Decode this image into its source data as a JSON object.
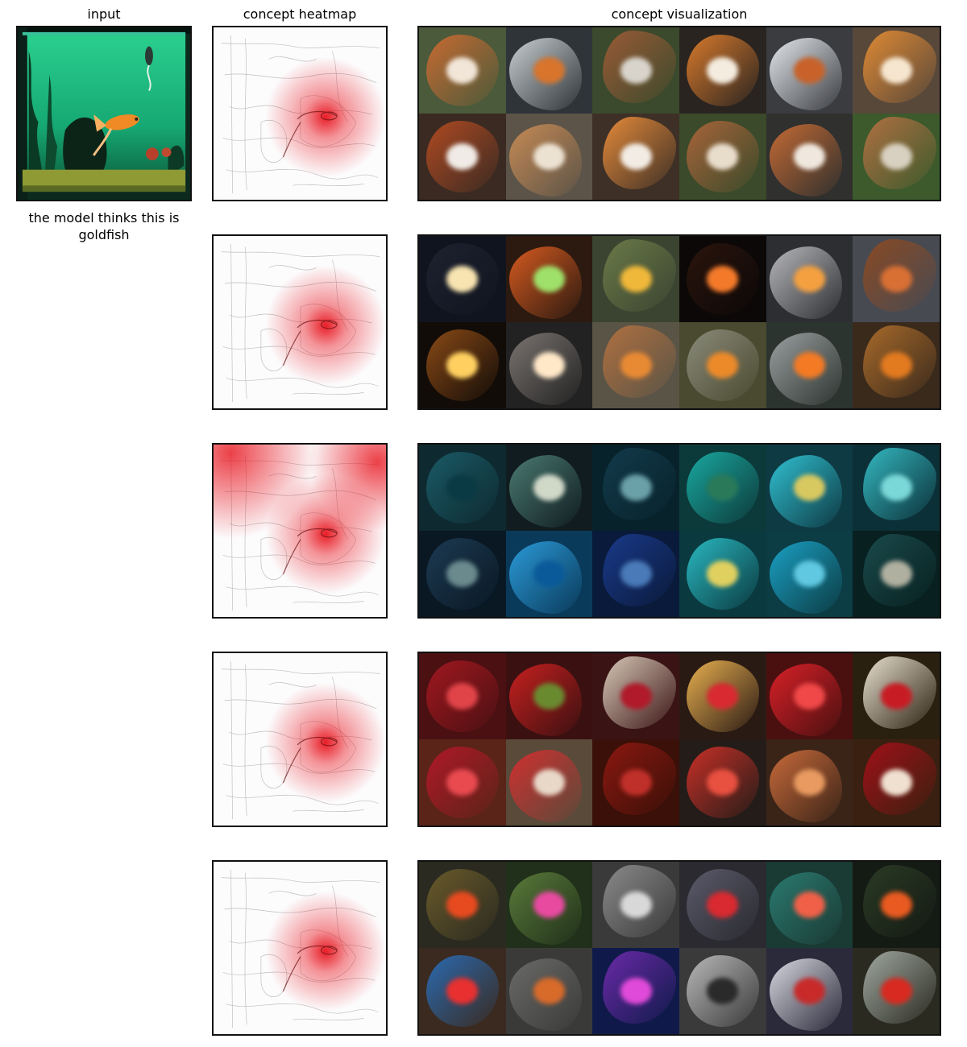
{
  "headers": {
    "input": "input",
    "heatmap": "concept heatmap",
    "visualization": "concept visualization"
  },
  "prediction_caption": "the model thinks this is goldfish",
  "input_image": {
    "description_icon": "aquarium-goldfish-image",
    "colors": {
      "water": "#1fbf7e",
      "deep": "#0f6a4a",
      "fish": "#f08a24",
      "gravel": "#9aa63a",
      "frame": "#0c2a1e"
    }
  },
  "heatmap_color": "#e8121c",
  "concepts": [
    {
      "heatmap_icon": "fish-heatmap-icon",
      "heat_spread": "focused",
      "tiles": [
        {
          "bg": "#4a5a3a",
          "blob": "#c86a32",
          "spot": "#f2e6d8"
        },
        {
          "bg": "#2e3438",
          "blob": "#c8cfd2",
          "spot": "#d8742c"
        },
        {
          "bg": "#3b4a2c",
          "blob": "#9a5a36",
          "spot": "#d8d4cc"
        },
        {
          "bg": "#2a2420",
          "blob": "#d87a2c",
          "spot": "#f4ecdf"
        },
        {
          "bg": "#3a3c40",
          "blob": "#e4e8ec",
          "spot": "#c8622a"
        },
        {
          "bg": "#58483a",
          "blob": "#e08a34",
          "spot": "#f6e6cf"
        },
        {
          "bg": "#3a2a22",
          "blob": "#b04a22",
          "spot": "#f0ebe6"
        },
        {
          "bg": "#5c5448",
          "blob": "#c68a54",
          "spot": "#ece2d2"
        },
        {
          "bg": "#3e3026",
          "blob": "#e48a3a",
          "spot": "#f2ece4"
        },
        {
          "bg": "#3a4a2a",
          "blob": "#a8643a",
          "spot": "#e8dccb"
        },
        {
          "bg": "#30302e",
          "blob": "#c46a34",
          "spot": "#f0e8de"
        },
        {
          "bg": "#3c5a2c",
          "blob": "#b07042",
          "spot": "#d8d0c0"
        }
      ]
    },
    {
      "heatmap_icon": "fish-heatmap-icon",
      "heat_spread": "focused",
      "tiles": [
        {
          "bg": "#10141e",
          "blob": "#1e2230",
          "spot": "#f8e4b0"
        },
        {
          "bg": "#2c1a10",
          "blob": "#d65a20",
          "spot": "#9ee06a"
        },
        {
          "bg": "#3a4430",
          "blob": "#6a7a48",
          "spot": "#f0b83a"
        },
        {
          "bg": "#0c0808",
          "blob": "#2a140c",
          "spot": "#f47a2a"
        },
        {
          "bg": "#2c2e32",
          "blob": "#b8b8bc",
          "spot": "#f4a040"
        },
        {
          "bg": "#484a52",
          "blob": "#8a4a24",
          "spot": "#d87034"
        },
        {
          "bg": "#120c08",
          "blob": "#8a4a16",
          "spot": "#ffd060"
        },
        {
          "bg": "#222222",
          "blob": "#7a7470",
          "spot": "#ffe8c8"
        },
        {
          "bg": "#5a5446",
          "blob": "#b07040",
          "spot": "#e88a34"
        },
        {
          "bg": "#4a4a30",
          "blob": "#8a8a7a",
          "spot": "#ec8a2a"
        },
        {
          "bg": "#2c3430",
          "blob": "#9aa0a0",
          "spot": "#f47a24"
        },
        {
          "bg": "#3a2a1c",
          "blob": "#a86a2a",
          "spot": "#e27a20"
        }
      ]
    },
    {
      "heatmap_icon": "fish-heatmap-icon",
      "heat_spread": "wide",
      "tiles": [
        {
          "bg": "#0e2a30",
          "blob": "#1a5a66",
          "spot": "#0a3a44"
        },
        {
          "bg": "#101c20",
          "blob": "#4a7a70",
          "spot": "#d0d8c8"
        },
        {
          "bg": "#08222c",
          "blob": "#123a4a",
          "spot": "#6aa0a8"
        },
        {
          "bg": "#0c3a3a",
          "blob": "#1aa8a0",
          "spot": "#2a7a5a"
        },
        {
          "bg": "#0e3a44",
          "blob": "#30c0d0",
          "spot": "#d8c860"
        },
        {
          "bg": "#0c3038",
          "blob": "#34b8c0",
          "spot": "#7ad8d8"
        },
        {
          "bg": "#0a1824",
          "blob": "#1c3a52",
          "spot": "#6a8a8e"
        },
        {
          "bg": "#0a3a5a",
          "blob": "#2a9ad8",
          "spot": "#0a5a9a"
        },
        {
          "bg": "#0a1a3a",
          "blob": "#1a3a8a",
          "spot": "#4a7ab8"
        },
        {
          "bg": "#0a3a40",
          "blob": "#2ab8c0",
          "spot": "#e0d060"
        },
        {
          "bg": "#0c3c44",
          "blob": "#1aa0c4",
          "spot": "#60c8e0"
        },
        {
          "bg": "#082020",
          "blob": "#1a4a4c",
          "spot": "#b0b0a0"
        }
      ]
    },
    {
      "heatmap_icon": "fish-heatmap-icon",
      "heat_spread": "focused",
      "tiles": [
        {
          "bg": "#4a1012",
          "blob": "#a01820",
          "spot": "#e04448"
        },
        {
          "bg": "#3a1010",
          "blob": "#c82020",
          "spot": "#6a8a30"
        },
        {
          "bg": "#3a1414",
          "blob": "#d8c8b8",
          "spot": "#b01a2a"
        },
        {
          "bg": "#2a1a14",
          "blob": "#e8b050",
          "spot": "#d82a30"
        },
        {
          "bg": "#4a1010",
          "blob": "#d82028",
          "spot": "#f04848"
        },
        {
          "bg": "#2a2010",
          "blob": "#e8e0d0",
          "spot": "#c81c24"
        },
        {
          "bg": "#5a2418",
          "blob": "#b01828",
          "spot": "#e84a50"
        },
        {
          "bg": "#5a4a3a",
          "blob": "#d03030",
          "spot": "#e8d8c8"
        },
        {
          "bg": "#3a1008",
          "blob": "#8a1810",
          "spot": "#c0302a"
        },
        {
          "bg": "#241c18",
          "blob": "#c83028",
          "spot": "#e85040"
        },
        {
          "bg": "#3a2418",
          "blob": "#c86a3a",
          "spot": "#e89a60"
        },
        {
          "bg": "#3a2010",
          "blob": "#a01018",
          "spot": "#f0e0d0"
        }
      ]
    },
    {
      "heatmap_icon": "fish-heatmap-icon",
      "heat_spread": "focused",
      "tiles": [
        {
          "bg": "#2a2a20",
          "blob": "#6a5a2a",
          "spot": "#e84a20"
        },
        {
          "bg": "#20301a",
          "blob": "#5a7a3a",
          "spot": "#e84aa0"
        },
        {
          "bg": "#3a3a3a",
          "blob": "#8a8a8a",
          "spot": "#d8d8d8"
        },
        {
          "bg": "#2a2a30",
          "blob": "#5a5a6a",
          "spot": "#d82a30"
        },
        {
          "bg": "#1a3a34",
          "blob": "#2a7a70",
          "spot": "#f06048"
        },
        {
          "bg": "#141a14",
          "blob": "#2a3a24",
          "spot": "#e85a20"
        },
        {
          "bg": "#3a2a20",
          "blob": "#2a6ab0",
          "spot": "#e83030"
        },
        {
          "bg": "#3a3a38",
          "blob": "#6a6a68",
          "spot": "#d86a2a"
        },
        {
          "bg": "#101a4a",
          "blob": "#6a2aa8",
          "spot": "#e04ad8"
        },
        {
          "bg": "#3a3a3a",
          "blob": "#b8b8b8",
          "spot": "#2a2a2a"
        },
        {
          "bg": "#2a2a3a",
          "blob": "#d8d8e0",
          "spot": "#c82a2a"
        },
        {
          "bg": "#2a2a20",
          "blob": "#a0a8a0",
          "spot": "#d82a20"
        }
      ]
    }
  ]
}
